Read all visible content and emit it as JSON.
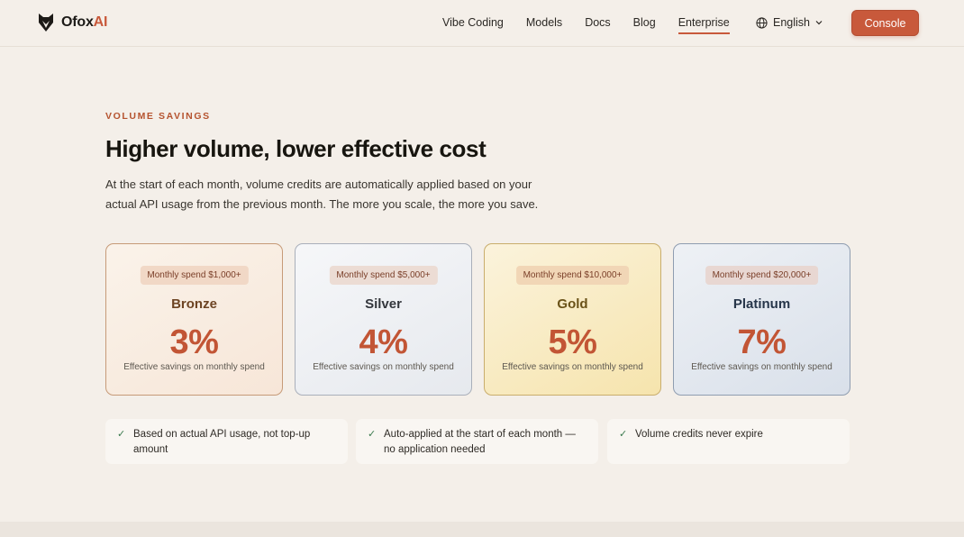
{
  "header": {
    "brand_name": "Ofox",
    "brand_suffix": "AI",
    "nav": [
      {
        "label": "Vibe Coding"
      },
      {
        "label": "Models"
      },
      {
        "label": "Docs"
      },
      {
        "label": "Blog"
      },
      {
        "label": "Enterprise",
        "active": true
      }
    ],
    "language": "English",
    "console_label": "Console"
  },
  "hero": {
    "eyebrow": "VOLUME SAVINGS",
    "title": "Higher volume, lower effective cost",
    "description": "At the start of each month, volume credits are automatically applied based on your actual API usage from the previous month. The more you scale, the more you save."
  },
  "tiers": [
    {
      "spend": "Monthly spend $1,000+",
      "name": "Bronze",
      "savings": "3%",
      "caption": "Effective savings on monthly spend"
    },
    {
      "spend": "Monthly spend $5,000+",
      "name": "Silver",
      "savings": "4%",
      "caption": "Effective savings on monthly spend"
    },
    {
      "spend": "Monthly spend $10,000+",
      "name": "Gold",
      "savings": "5%",
      "caption": "Effective savings on monthly spend"
    },
    {
      "spend": "Monthly spend $20,000+",
      "name": "Platinum",
      "savings": "7%",
      "caption": "Effective savings on monthly spend"
    }
  ],
  "features": [
    {
      "text": "Based on actual API usage, not top-up amount"
    },
    {
      "text": "Auto-applied at the start of each month — no application needed"
    },
    {
      "text": "Volume credits never expire"
    }
  ],
  "colors": {
    "accent": "#c8593b",
    "background": "#f4efe9"
  }
}
